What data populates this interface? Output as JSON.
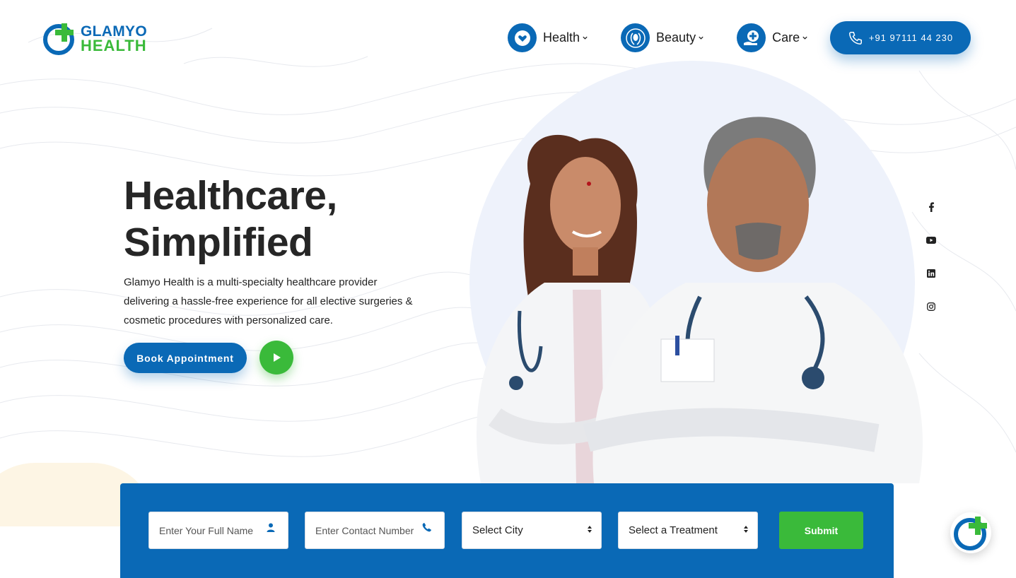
{
  "brand": {
    "line1": "GLAMYO",
    "line2": "HEALTH",
    "blue": "#0a69b6",
    "green": "#3aba3a"
  },
  "nav": {
    "items": [
      {
        "label": "Health",
        "icon": "heart-hands-icon"
      },
      {
        "label": "Beauty",
        "icon": "woman-face-icon"
      },
      {
        "label": "Care",
        "icon": "care-hand-icon"
      }
    ],
    "phone": "+91 97111 44 230"
  },
  "hero": {
    "title_line1": "Healthcare,",
    "title_line2": "Simplified",
    "description": "Glamyo Health is a multi-specialty healthcare provider delivering a hassle-free experience for all elective surgeries & cosmetic procedures with personalized care.",
    "book_label": "Book Appointment",
    "play_icon": "play-icon"
  },
  "socials": [
    "facebook-icon",
    "youtube-icon",
    "linkedin-icon",
    "instagram-icon"
  ],
  "form": {
    "name_placeholder": "Enter Your Full Name",
    "contact_placeholder": "Enter Contact Number",
    "city_label": "Select City",
    "treatment_label": "Select a Treatment",
    "submit_label": "Submit"
  }
}
